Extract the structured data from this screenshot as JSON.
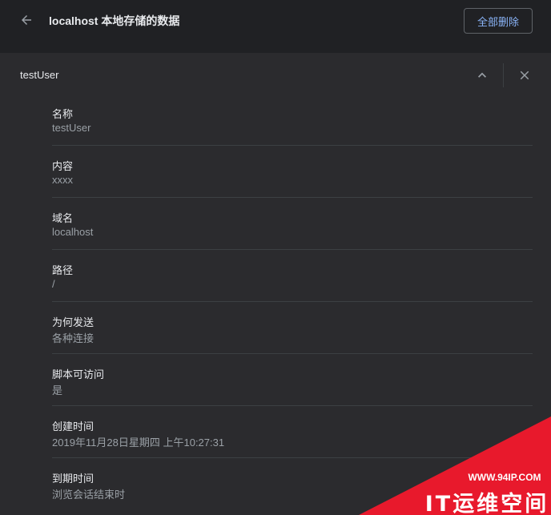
{
  "header": {
    "title": "localhost 本地存储的数据",
    "remove_all_label": "全部删除",
    "back_icon": "arrow-back-icon"
  },
  "cookie": {
    "title": "testUser",
    "collapse_icon": "chevron-up-icon",
    "close_icon": "close-icon",
    "fields": [
      {
        "label": "名称",
        "value": "testUser"
      },
      {
        "label": "内容",
        "value": "xxxx"
      },
      {
        "label": "域名",
        "value": "localhost"
      },
      {
        "label": "路径",
        "value": "/"
      },
      {
        "label": "为何发送",
        "value": "各种连接"
      },
      {
        "label": "脚本可访问",
        "value": "是"
      },
      {
        "label": "创建时间",
        "value": "2019年11月28日星期四 上午10:27:31"
      },
      {
        "label": "到期时间",
        "value": "浏览会话结束时"
      }
    ]
  },
  "watermark": {
    "url": "WWW.94IP.COM",
    "brand": "IT运维空间"
  },
  "colors": {
    "background": "#202124",
    "card": "#2b2b2e",
    "accent": "#8ab4f8",
    "divider": "#3c4043",
    "watermark": "#e8192c"
  }
}
